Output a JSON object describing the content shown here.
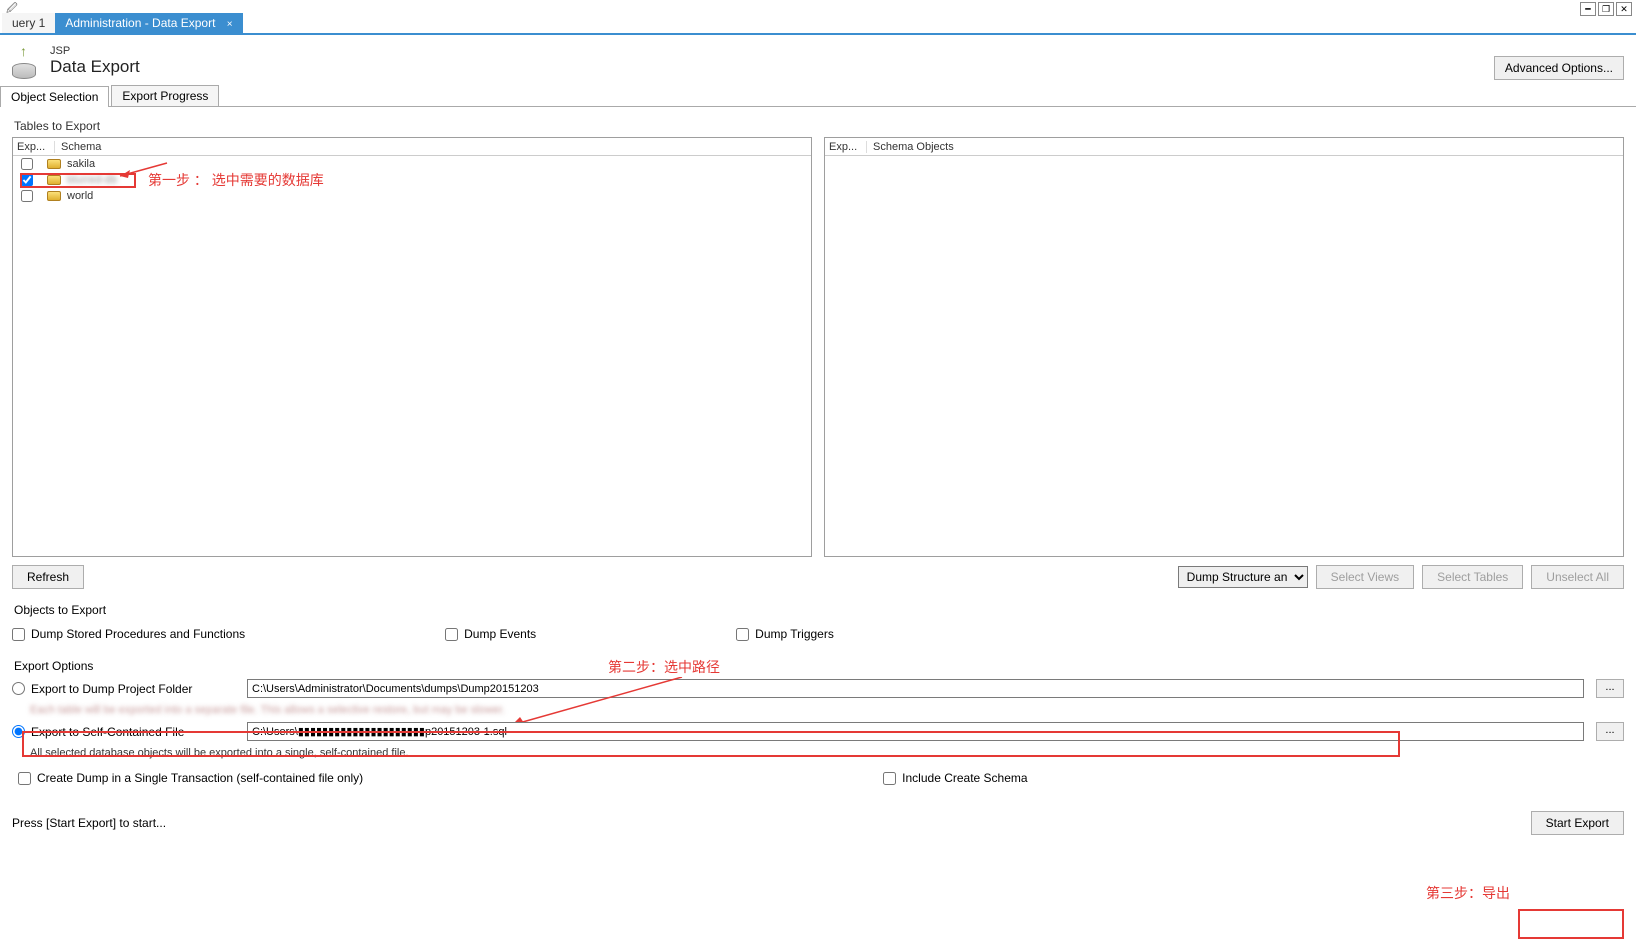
{
  "topbar_hint": "🖉",
  "tabs": {
    "query": "uery 1",
    "admin": "Administration - Data Export",
    "close": "×"
  },
  "header": {
    "small": "JSP",
    "big": "Data Export",
    "advanced": "Advanced Options..."
  },
  "sub_tabs": {
    "obj_sel": "Object Selection",
    "exp_prog": "Export Progress"
  },
  "tables_to_export": "Tables to Export",
  "pane_left": {
    "col1": "Exp...",
    "col2": "Schema"
  },
  "pane_right": {
    "col1": "Exp...",
    "col2": "Schema Objects"
  },
  "schemas": [
    {
      "name": "sakila",
      "checked": false,
      "blur": false
    },
    {
      "name": "blurred-db",
      "checked": true,
      "blur": true
    },
    {
      "name": "world",
      "checked": false,
      "blur": false
    }
  ],
  "annotations": {
    "step1": "第一步 ： 选中需要的数据库",
    "step2": "第二步：选中路径",
    "step3": "第三步：导出"
  },
  "refresh": "Refresh",
  "dump_dropdown": "Dump Structure and Dat",
  "select_views": "Select Views",
  "select_tables": "Select Tables",
  "unselect_all": "Unselect All",
  "objects_to_export": "Objects to Export",
  "dump_sp": "Dump Stored Procedures and Functions",
  "dump_events": "Dump Events",
  "dump_triggers": "Dump Triggers",
  "export_options": "Export Options",
  "export_folder": "Export to Dump Project Folder",
  "export_folder_path": "C:\\Users\\Administrator\\Documents\\dumps\\Dump20151203",
  "folder_desc_blur": "Each table will be exported into a separate file. This allows a selective restore, but may be slower.",
  "export_self": "Export to Self-Contained File",
  "export_self_path": "C:\\Users\\▮▮▮▮▮▮▮▮▮▮▮▮▮▮▮▮▮▮▮▮▮p20151203-1.sql",
  "self_desc": "All selected database objects will be exported into a single, self-contained file.",
  "single_tx": "Create Dump in a Single Transaction (self-contained file only)",
  "include_schema": "Include Create Schema",
  "footer": "Press [Start Export] to start...",
  "start_export": "Start Export",
  "browse": "..."
}
